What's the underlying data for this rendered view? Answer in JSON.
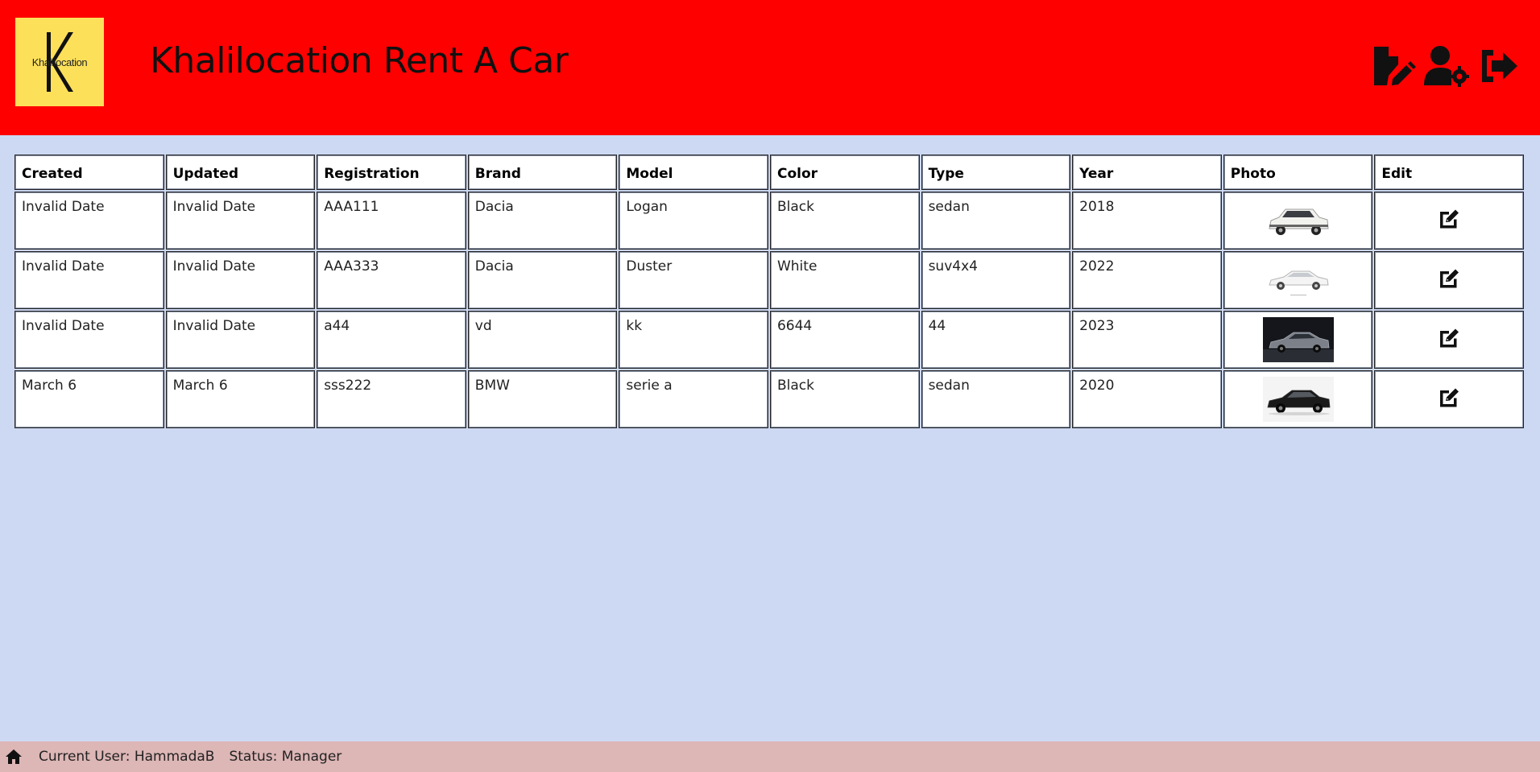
{
  "header": {
    "logo_text": "Khalilocation",
    "title": "Khalilocation Rent A Car",
    "icons": [
      "file-edit-icon",
      "user-settings-icon",
      "logout-icon"
    ],
    "background_color": "#ff0000",
    "logo_background": "#fde05a"
  },
  "table": {
    "columns": [
      "Created",
      "Updated",
      "Registration",
      "Brand",
      "Model",
      "Color",
      "Type",
      "Year",
      "Photo",
      "Edit"
    ],
    "rows": [
      {
        "created": "Invalid Date",
        "updated": "Invalid Date",
        "registration": "AAA111",
        "brand": "Dacia",
        "model": "Logan",
        "color": "Black",
        "type": "sedan",
        "year": "2018",
        "photo": "white-suv-photo",
        "edit": "edit-icon"
      },
      {
        "created": "Invalid Date",
        "updated": "Invalid Date",
        "registration": "AAA333",
        "brand": "Dacia",
        "model": "Duster",
        "color": "White",
        "type": "suv4x4",
        "year": "2022",
        "photo": "white-sedan-photo",
        "edit": "edit-icon"
      },
      {
        "created": "Invalid Date",
        "updated": "Invalid Date",
        "registration": "a44",
        "brand": "vd",
        "model": "kk",
        "color": "6644",
        "type": "44",
        "year": "2023",
        "photo": "grey-sedan-dark-background-photo",
        "edit": "edit-icon"
      },
      {
        "created": "March 6",
        "updated": "March 6",
        "registration": "sss222",
        "brand": "BMW",
        "model": "serie a",
        "color": "Black",
        "type": "sedan",
        "year": "2020",
        "photo": "black-sedan-photo",
        "edit": "edit-icon"
      }
    ]
  },
  "footer": {
    "current_user": "Current User: HammadaB",
    "status": "Status: Manager",
    "background_color": "#ddb6b6"
  },
  "page_background": "#cdd9f3"
}
